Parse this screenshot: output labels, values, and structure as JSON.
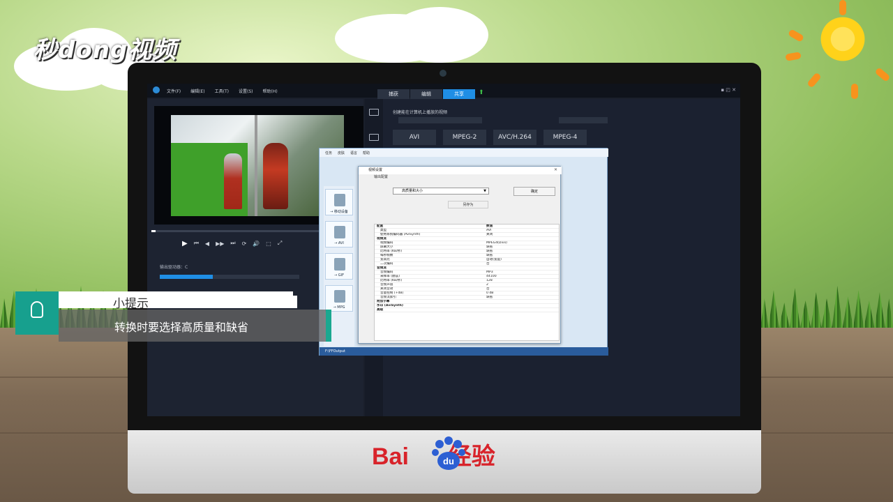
{
  "branding": {
    "logo_text": "秒dong视频",
    "footer_logo_bai": "Bai",
    "footer_logo_du": "du",
    "footer_logo_cn": "经验"
  },
  "app": {
    "menu": [
      "文件(F)",
      "编辑(E)",
      "工具(T)",
      "设置(S)",
      "帮助(H)"
    ],
    "tabs": [
      {
        "label": "捕获",
        "active": false
      },
      {
        "label": "编辑",
        "active": false
      },
      {
        "label": "共享",
        "active": true
      }
    ],
    "window_controls": "▪ ◰ ✕",
    "player": {
      "controls": [
        "▶",
        "⏮",
        "◀",
        "▶▶",
        "⏭",
        "⟳",
        "🔊",
        "⬚",
        "⤢"
      ]
    },
    "drive_label": "输出驱动器：C",
    "share": {
      "title": "创建能在计算机上播放的视频",
      "formats": [
        "AVI",
        "MPEG-2",
        "AVC/H.264",
        "MPEG-4"
      ]
    }
  },
  "factory": {
    "menu": [
      "任务",
      "皮肤",
      "语言",
      "帮助"
    ],
    "list_items": [
      "→ 移动设备",
      "→ AVI",
      "→ GIF",
      "→ MPG"
    ],
    "status_path": "F:\\FFOutput"
  },
  "video_settings": {
    "title": "视频设置",
    "subtitle": "输出配置",
    "profile": "高质量和大小",
    "ok": "确定",
    "save_as": "另存为",
    "table_head": {
      "key": "配置",
      "value": "数值"
    },
    "rows": [
      {
        "k": "类型",
        "v": "AVI"
      },
      {
        "k": "使用系统编码器 (AviSynth)",
        "v": "关闭"
      },
      {
        "k": "视频流",
        "v": "",
        "section": true
      },
      {
        "k": "视频编码",
        "v": "MPEG4(Divx)"
      },
      {
        "k": "屏幕大小",
        "v": "缺省"
      },
      {
        "k": "比特率 (KB/秒)",
        "v": "缺省"
      },
      {
        "k": "每秒帧数",
        "v": "缺省"
      },
      {
        "k": "宽高比",
        "v": "自动(宽度)"
      },
      {
        "k": "二次编码",
        "v": "否"
      },
      {
        "k": "音频流",
        "v": "",
        "section": true
      },
      {
        "k": "音频编码",
        "v": "MP3"
      },
      {
        "k": "采样率 (赫兹)",
        "v": "44100"
      },
      {
        "k": "比特率 (KB/秒)",
        "v": "128"
      },
      {
        "k": "音频声道",
        "v": "2"
      },
      {
        "k": "关闭音效",
        "v": "否"
      },
      {
        "k": "音量控制 (+dB)",
        "v": "0 dB"
      },
      {
        "k": "音频流索引",
        "v": "缺省"
      },
      {
        "k": "附加字幕",
        "v": "",
        "section": true
      },
      {
        "k": "水印 (AviSynth)",
        "v": "",
        "section": true
      },
      {
        "k": "高级",
        "v": "",
        "section": true
      }
    ]
  },
  "tip": {
    "title": "小提示",
    "text": "转换时要选择高质量和缺省"
  }
}
